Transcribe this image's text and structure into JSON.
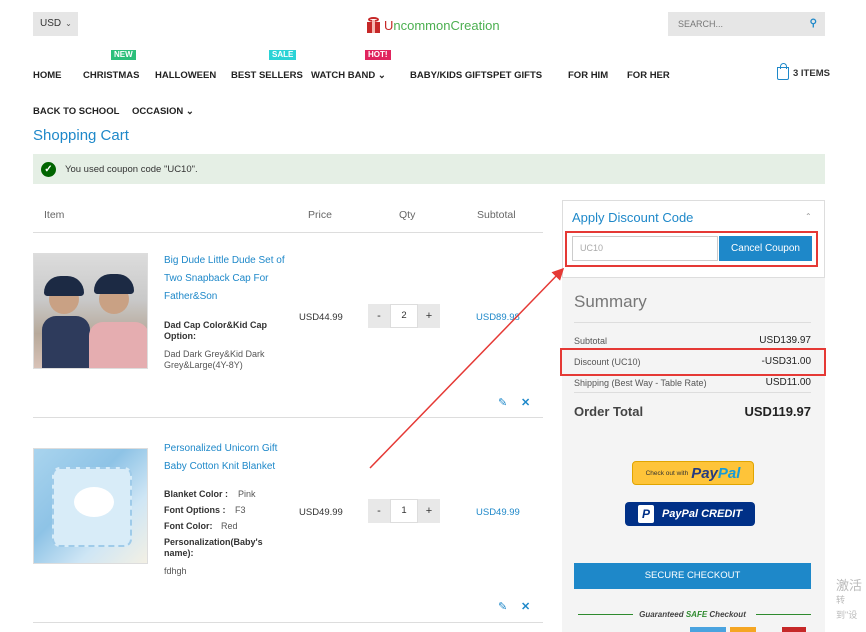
{
  "header": {
    "currency": "USD",
    "logo_prefix": "U",
    "logo_text": "ncommonCreation",
    "search_placeholder": "SEARCH...",
    "cart_count": "3 ITEMS"
  },
  "nav": {
    "badges": {
      "new": "NEW",
      "sale": "SALE",
      "hot": "HOT!"
    },
    "items": [
      "HOME",
      "CHRISTMAS",
      "HALLOWEEN",
      "BEST SELLERS",
      "WATCH BAND",
      "BABY/KIDS GIFTS",
      "PET GIFTS",
      "FOR HIM",
      "FOR HER"
    ],
    "items_row2": [
      "BACK TO SCHOOL",
      "OCCASION"
    ]
  },
  "page_title": "Shopping Cart",
  "notice": "You used coupon code \"UC10\".",
  "table": {
    "headers": {
      "item": "Item",
      "price": "Price",
      "qty": "Qty",
      "subtotal": "Subtotal"
    }
  },
  "products": [
    {
      "name": "Big Dude Little Dude Set of Two Snapback Cap For Father&Son",
      "options": [
        {
          "label": "Dad Cap Color&Kid Cap Option:",
          "value": "Dad Dark Grey&Kid Dark Grey&Large(4Y-8Y)"
        }
      ],
      "price": "USD44.99",
      "qty": "2",
      "subtotal": "USD89.98"
    },
    {
      "name": "Personalized Unicorn Gift Baby Cotton Knit Blanket",
      "options": [
        {
          "label": "Blanket Color :",
          "value": "Pink"
        },
        {
          "label": "Font Options :",
          "value": "F3"
        },
        {
          "label": "Font Color:",
          "value": "Red"
        },
        {
          "label": "Personalization(Baby's name):",
          "value": "fdhgh"
        }
      ],
      "price": "USD49.99",
      "qty": "1",
      "subtotal": "USD49.99"
    }
  ],
  "discount": {
    "title": "Apply Discount Code",
    "code_value": "UC10",
    "button": "Cancel Coupon"
  },
  "summary": {
    "title": "Summary",
    "rows": [
      {
        "label": "Subtotal",
        "value": "USD139.97"
      },
      {
        "label": "Discount (UC10)",
        "value": "-USD31.00"
      },
      {
        "label": "Shipping (Best Way - Table Rate)",
        "value": "USD11.00"
      }
    ],
    "total_label": "Order Total",
    "total_value": "USD119.97"
  },
  "payment": {
    "paypal_prefix": "Check out with",
    "paypal_brand_a": "Pay",
    "paypal_brand_b": "Pal",
    "paypal_credit": "PayPal CREDIT",
    "secure_checkout": "SECURE CHECKOUT",
    "guaranteed_pre": "Guaranteed",
    "guaranteed_safe": "SAFE",
    "guaranteed_post": "Checkout"
  },
  "watermark": {
    "line1": "激活",
    "line2": "转到\"设"
  },
  "colors": {
    "accent": "#1e88c9",
    "highlight": "#e53935",
    "notice_bg": "#e5efe5",
    "success": "#006400"
  }
}
